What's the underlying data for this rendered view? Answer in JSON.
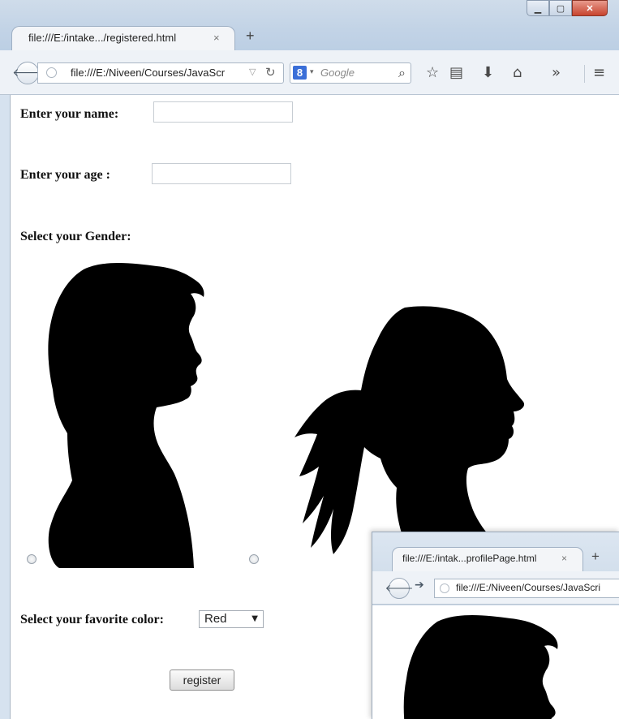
{
  "browser": {
    "tab_title": "file:///E:/intake.../registered.html",
    "tab_close": "×",
    "new_tab": "+",
    "window_buttons": {
      "minimize": "▁",
      "maximize": "▢",
      "close": "✕"
    },
    "url": "file:///E:/Niveen/Courses/JavaScr",
    "search_placeholder": "Google",
    "search_engine_letter": "8",
    "back_glyph": "🡐",
    "toolbar_icons": [
      "star-icon",
      "reading-list-icon",
      "download-icon",
      "home-icon",
      "overflow-icon",
      "menu-icon"
    ]
  },
  "form": {
    "name_label": "Enter your name:",
    "name_value": "",
    "age_label": "Enter your age :",
    "age_value": "",
    "gender_label": "Select your Gender:",
    "gender_options": [
      "male-silhouette",
      "female-silhouette"
    ],
    "color_label": "Select your favorite color:",
    "color_value": "Red",
    "register_button": "register"
  },
  "second_window": {
    "tab_title": "file:///E:/intak...profilePage.html",
    "tab_close": "×",
    "new_tab": "+",
    "url": "file:///E:/Niveen/Courses/JavaScri"
  }
}
